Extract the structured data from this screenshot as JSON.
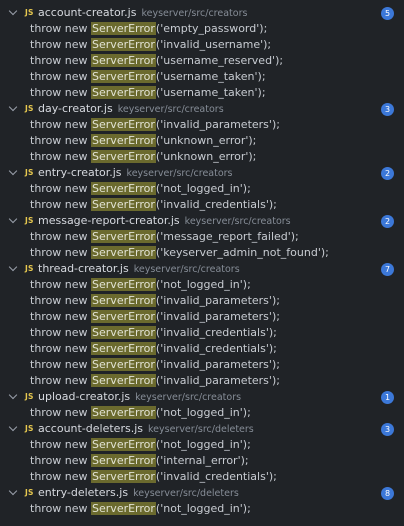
{
  "match_prefix": "throw new",
  "match_term": "ServerError",
  "colors": {
    "background": "#202327",
    "highlight": "#6b6a2e",
    "badge": "#3c78d8",
    "js_icon": "#e6c84f"
  },
  "results": [
    {
      "file": "account-creator.js",
      "path": "keyserver/src/creators",
      "count": "5",
      "matches": [
        "('empty_password');",
        "('invalid_username');",
        "('username_reserved');",
        "('username_taken');",
        "('username_taken');"
      ]
    },
    {
      "file": "day-creator.js",
      "path": "keyserver/src/creators",
      "count": "3",
      "matches": [
        "('invalid_parameters');",
        "('unknown_error');",
        "('unknown_error');"
      ]
    },
    {
      "file": "entry-creator.js",
      "path": "keyserver/src/creators",
      "count": "2",
      "matches": [
        "('not_logged_in');",
        "('invalid_credentials');"
      ]
    },
    {
      "file": "message-report-creator.js",
      "path": "keyserver/src/creators",
      "count": "2",
      "matches": [
        "('message_report_failed');",
        "('keyserver_admin_not_found');"
      ]
    },
    {
      "file": "thread-creator.js",
      "path": "keyserver/src/creators",
      "count": "7",
      "matches": [
        "('not_logged_in');",
        "('invalid_parameters');",
        "('invalid_parameters');",
        "('invalid_credentials');",
        "('invalid_credentials');",
        "('invalid_parameters');",
        "('invalid_parameters');"
      ]
    },
    {
      "file": "upload-creator.js",
      "path": "keyserver/src/creators",
      "count": "1",
      "matches": [
        "('not_logged_in');"
      ]
    },
    {
      "file": "account-deleters.js",
      "path": "keyserver/src/deleters",
      "count": "3",
      "matches": [
        "('not_logged_in');",
        "('internal_error');",
        "('invalid_credentials');"
      ]
    },
    {
      "file": "entry-deleters.js",
      "path": "keyserver/src/deleters",
      "count": "8",
      "matches": [
        "('not_logged_in');"
      ]
    }
  ]
}
